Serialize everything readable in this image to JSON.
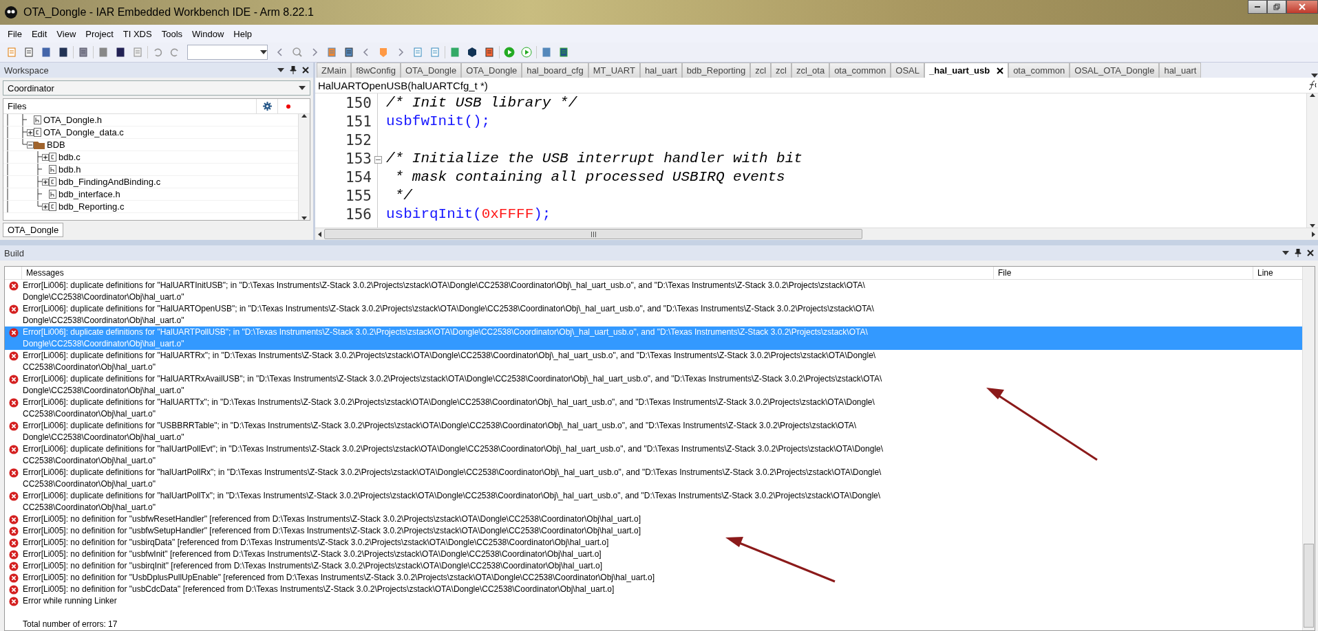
{
  "window": {
    "title": "OTA_Dongle - IAR Embedded Workbench IDE - Arm 8.22.1"
  },
  "menu": [
    "File",
    "Edit",
    "View",
    "Project",
    "TI XDS",
    "Tools",
    "Window",
    "Help"
  ],
  "workspace": {
    "title": "Workspace",
    "configuration": "Coordinator",
    "files_header": "Files",
    "bottom_tab": "OTA_Dongle",
    "tree": [
      {
        "label": "OTA_Dongle.h",
        "kind": "header"
      },
      {
        "label": "OTA_Dongle_data.c",
        "kind": "source",
        "expanded": false
      },
      {
        "label": "BDB",
        "kind": "folder",
        "expanded": true,
        "children": [
          {
            "label": "bdb.c",
            "kind": "source",
            "expanded": false
          },
          {
            "label": "bdb.h",
            "kind": "header"
          },
          {
            "label": "bdb_FindingAndBinding.c",
            "kind": "source",
            "expanded": false
          },
          {
            "label": "bdb_interface.h",
            "kind": "header"
          },
          {
            "label": "bdb_Reporting.c",
            "kind": "source",
            "expanded": false
          }
        ]
      }
    ]
  },
  "editor": {
    "tabs": [
      {
        "label": "ZMain",
        "selected": false
      },
      {
        "label": "f8wConfig",
        "selected": false
      },
      {
        "label": "OTA_Dongle",
        "selected": false
      },
      {
        "label": "OTA_Dongle",
        "selected": false
      },
      {
        "label": "hal_board_cfg",
        "selected": false
      },
      {
        "label": "MT_UART",
        "selected": false
      },
      {
        "label": "hal_uart",
        "selected": false
      },
      {
        "label": "bdb_Reporting",
        "selected": false
      },
      {
        "label": "zcl",
        "selected": false
      },
      {
        "label": "zcl",
        "selected": false
      },
      {
        "label": "zcl_ota",
        "selected": false
      },
      {
        "label": "ota_common",
        "selected": false
      },
      {
        "label": "OSAL",
        "selected": false
      },
      {
        "label": "_hal_uart_usb",
        "selected": true
      },
      {
        "label": "ota_common",
        "selected": false
      },
      {
        "label": "OSAL_OTA_Dongle",
        "selected": false
      },
      {
        "label": "hal_uart",
        "selected": false
      }
    ],
    "function": "HalUARTOpenUSB(halUARTCfg_t *)",
    "lines": [
      {
        "number": "150",
        "fold": false,
        "tokens": [
          {
            "kind": "comment",
            "text": "/* Init USB library */"
          }
        ]
      },
      {
        "number": "151",
        "fold": false,
        "tokens": [
          {
            "kind": "call",
            "text": "usbfwInit();"
          }
        ]
      },
      {
        "number": "152",
        "fold": false
      },
      {
        "number": "153",
        "fold": true,
        "tokens": [
          {
            "kind": "comment",
            "text": "/* Initialize the USB interrupt handler with bit"
          }
        ]
      },
      {
        "number": "154",
        "fold": false,
        "tokens": [
          {
            "kind": "comment",
            "text": " * mask containing all processed USBIRQ events"
          }
        ]
      },
      {
        "number": "155",
        "fold": false,
        "tokens": [
          {
            "kind": "comment",
            "text": " */"
          }
        ]
      },
      {
        "number": "156",
        "fold": false,
        "tokens": [
          {
            "kind": "call",
            "text": "usbirqInit("
          },
          {
            "kind": "number",
            "text": "0xFFFF"
          },
          {
            "kind": "call",
            "text": ");"
          }
        ]
      }
    ]
  },
  "build": {
    "title": "Build",
    "columns": [
      "Messages",
      "File",
      "Line"
    ],
    "messages": [
      {
        "kind": "error",
        "selected": false,
        "lines": [
          "Error[Li006]: duplicate definitions for \"HalUARTInitUSB\"; in \"D:\\Texas Instruments\\Z-Stack 3.0.2\\Projects\\zstack\\OTA\\Dongle\\CC2538\\Coordinator\\Obj\\_hal_uart_usb.o\", and \"D:\\Texas Instruments\\Z-Stack 3.0.2\\Projects\\zstack\\OTA\\",
          "Dongle\\CC2538\\Coordinator\\Obj\\hal_uart.o\""
        ]
      },
      {
        "kind": "error",
        "selected": false,
        "lines": [
          "Error[Li006]: duplicate definitions for \"HalUARTOpenUSB\"; in \"D:\\Texas Instruments\\Z-Stack 3.0.2\\Projects\\zstack\\OTA\\Dongle\\CC2538\\Coordinator\\Obj\\_hal_uart_usb.o\", and \"D:\\Texas Instruments\\Z-Stack 3.0.2\\Projects\\zstack\\OTA\\",
          "Dongle\\CC2538\\Coordinator\\Obj\\hal_uart.o\""
        ]
      },
      {
        "kind": "error",
        "selected": true,
        "lines": [
          "Error[Li006]: duplicate definitions for \"HalUARTPollUSB\"; in \"D:\\Texas Instruments\\Z-Stack 3.0.2\\Projects\\zstack\\OTA\\Dongle\\CC2538\\Coordinator\\Obj\\_hal_uart_usb.o\", and \"D:\\Texas Instruments\\Z-Stack 3.0.2\\Projects\\zstack\\OTA\\",
          "Dongle\\CC2538\\Coordinator\\Obj\\hal_uart.o\""
        ]
      },
      {
        "kind": "error",
        "selected": false,
        "lines": [
          "Error[Li006]: duplicate definitions for \"HalUARTRx\"; in \"D:\\Texas Instruments\\Z-Stack 3.0.2\\Projects\\zstack\\OTA\\Dongle\\CC2538\\Coordinator\\Obj\\_hal_uart_usb.o\", and \"D:\\Texas Instruments\\Z-Stack 3.0.2\\Projects\\zstack\\OTA\\Dongle\\",
          "CC2538\\Coordinator\\Obj\\hal_uart.o\""
        ]
      },
      {
        "kind": "error",
        "selected": false,
        "lines": [
          "Error[Li006]: duplicate definitions for \"HalUARTRxAvailUSB\"; in \"D:\\Texas Instruments\\Z-Stack 3.0.2\\Projects\\zstack\\OTA\\Dongle\\CC2538\\Coordinator\\Obj\\_hal_uart_usb.o\", and \"D:\\Texas Instruments\\Z-Stack 3.0.2\\Projects\\zstack\\OTA\\",
          "Dongle\\CC2538\\Coordinator\\Obj\\hal_uart.o\""
        ]
      },
      {
        "kind": "error",
        "selected": false,
        "lines": [
          "Error[Li006]: duplicate definitions for \"HalUARTTx\"; in \"D:\\Texas Instruments\\Z-Stack 3.0.2\\Projects\\zstack\\OTA\\Dongle\\CC2538\\Coordinator\\Obj\\_hal_uart_usb.o\", and \"D:\\Texas Instruments\\Z-Stack 3.0.2\\Projects\\zstack\\OTA\\Dongle\\",
          "CC2538\\Coordinator\\Obj\\hal_uart.o\""
        ]
      },
      {
        "kind": "error",
        "selected": false,
        "lines": [
          "Error[Li006]: duplicate definitions for \"USBBRRTable\"; in \"D:\\Texas Instruments\\Z-Stack 3.0.2\\Projects\\zstack\\OTA\\Dongle\\CC2538\\Coordinator\\Obj\\_hal_uart_usb.o\", and \"D:\\Texas Instruments\\Z-Stack 3.0.2\\Projects\\zstack\\OTA\\",
          "Dongle\\CC2538\\Coordinator\\Obj\\hal_uart.o\""
        ]
      },
      {
        "kind": "error",
        "selected": false,
        "lines": [
          "Error[Li006]: duplicate definitions for \"halUartPollEvt\"; in \"D:\\Texas Instruments\\Z-Stack 3.0.2\\Projects\\zstack\\OTA\\Dongle\\CC2538\\Coordinator\\Obj\\_hal_uart_usb.o\", and \"D:\\Texas Instruments\\Z-Stack 3.0.2\\Projects\\zstack\\OTA\\Dongle\\",
          "CC2538\\Coordinator\\Obj\\hal_uart.o\""
        ]
      },
      {
        "kind": "error",
        "selected": false,
        "lines": [
          "Error[Li006]: duplicate definitions for \"halUartPollRx\"; in \"D:\\Texas Instruments\\Z-Stack 3.0.2\\Projects\\zstack\\OTA\\Dongle\\CC2538\\Coordinator\\Obj\\_hal_uart_usb.o\", and \"D:\\Texas Instruments\\Z-Stack 3.0.2\\Projects\\zstack\\OTA\\Dongle\\",
          "CC2538\\Coordinator\\Obj\\hal_uart.o\""
        ]
      },
      {
        "kind": "error",
        "selected": false,
        "lines": [
          "Error[Li006]: duplicate definitions for \"halUartPollTx\"; in \"D:\\Texas Instruments\\Z-Stack 3.0.2\\Projects\\zstack\\OTA\\Dongle\\CC2538\\Coordinator\\Obj\\_hal_uart_usb.o\", and \"D:\\Texas Instruments\\Z-Stack 3.0.2\\Projects\\zstack\\OTA\\Dongle\\",
          "CC2538\\Coordinator\\Obj\\hal_uart.o\""
        ]
      },
      {
        "kind": "error",
        "selected": false,
        "lines": [
          "Error[Li005]: no definition for \"usbfwResetHandler\" [referenced from D:\\Texas Instruments\\Z-Stack 3.0.2\\Projects\\zstack\\OTA\\Dongle\\CC2538\\Coordinator\\Obj\\hal_uart.o]"
        ]
      },
      {
        "kind": "error",
        "selected": false,
        "lines": [
          "Error[Li005]: no definition for \"usbfwSetupHandler\" [referenced from D:\\Texas Instruments\\Z-Stack 3.0.2\\Projects\\zstack\\OTA\\Dongle\\CC2538\\Coordinator\\Obj\\hal_uart.o]"
        ]
      },
      {
        "kind": "error",
        "selected": false,
        "lines": [
          "Error[Li005]: no definition for \"usbirqData\" [referenced from D:\\Texas Instruments\\Z-Stack 3.0.2\\Projects\\zstack\\OTA\\Dongle\\CC2538\\Coordinator\\Obj\\hal_uart.o]"
        ]
      },
      {
        "kind": "error",
        "selected": false,
        "lines": [
          "Error[Li005]: no definition for \"usbfwInit\" [referenced from D:\\Texas Instruments\\Z-Stack 3.0.2\\Projects\\zstack\\OTA\\Dongle\\CC2538\\Coordinator\\Obj\\hal_uart.o]"
        ]
      },
      {
        "kind": "error",
        "selected": false,
        "lines": [
          "Error[Li005]: no definition for \"usbirqInit\" [referenced from D:\\Texas Instruments\\Z-Stack 3.0.2\\Projects\\zstack\\OTA\\Dongle\\CC2538\\Coordinator\\Obj\\hal_uart.o]"
        ]
      },
      {
        "kind": "error",
        "selected": false,
        "lines": [
          "Error[Li005]: no definition for \"UsbDplusPullUpEnable\" [referenced from D:\\Texas Instruments\\Z-Stack 3.0.2\\Projects\\zstack\\OTA\\Dongle\\CC2538\\Coordinator\\Obj\\hal_uart.o]"
        ]
      },
      {
        "kind": "error",
        "selected": false,
        "lines": [
          "Error[Li005]: no definition for \"usbCdcData\" [referenced from D:\\Texas Instruments\\Z-Stack 3.0.2\\Projects\\zstack\\OTA\\Dongle\\CC2538\\Coordinator\\Obj\\hal_uart.o]"
        ]
      },
      {
        "kind": "error",
        "selected": false,
        "lines": [
          "Error while running Linker"
        ]
      },
      {
        "kind": "blank",
        "selected": false
      },
      {
        "kind": "info",
        "selected": false,
        "lines": [
          "Total number of errors: 17"
        ]
      }
    ]
  }
}
